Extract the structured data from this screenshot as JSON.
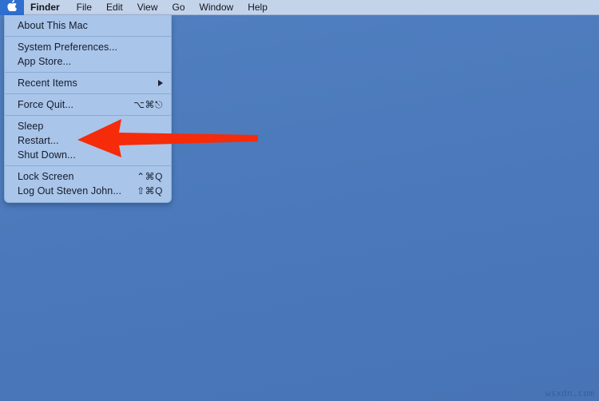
{
  "colors": {
    "desktop": "#4d7cbd",
    "menubar_bg": "#c3d3ea",
    "menu_bg": "#a9c5e9",
    "apple_highlight": "#2f6fd0",
    "arrow_red": "#f52b0a",
    "text": "#151b2c"
  },
  "menubar": {
    "apple_icon": "apple-logo-icon",
    "apple_glyph": "",
    "items": [
      {
        "label": "Finder",
        "bold": true
      },
      {
        "label": "File",
        "bold": false
      },
      {
        "label": "Edit",
        "bold": false
      },
      {
        "label": "View",
        "bold": false
      },
      {
        "label": "Go",
        "bold": false
      },
      {
        "label": "Window",
        "bold": false
      },
      {
        "label": "Help",
        "bold": false
      }
    ]
  },
  "apple_menu": {
    "groups": [
      {
        "items": [
          {
            "label": "About This Mac",
            "shortcut": "",
            "submenu": false
          }
        ]
      },
      {
        "items": [
          {
            "label": "System Preferences...",
            "shortcut": "",
            "submenu": false
          },
          {
            "label": "App Store...",
            "shortcut": "",
            "submenu": false
          }
        ]
      },
      {
        "items": [
          {
            "label": "Recent Items",
            "shortcut": "",
            "submenu": true
          }
        ]
      },
      {
        "items": [
          {
            "label": "Force Quit...",
            "shortcut": "⌥⌘⎋",
            "submenu": false
          }
        ]
      },
      {
        "items": [
          {
            "label": "Sleep",
            "shortcut": "",
            "submenu": false
          },
          {
            "label": "Restart...",
            "shortcut": "",
            "submenu": false
          },
          {
            "label": "Shut Down...",
            "shortcut": "",
            "submenu": false
          }
        ]
      },
      {
        "items": [
          {
            "label": "Lock Screen",
            "shortcut": "⌃⌘Q",
            "submenu": false
          },
          {
            "label": "Log Out Steven John...",
            "shortcut": "⇧⌘Q",
            "submenu": false
          }
        ]
      }
    ]
  },
  "annotation": {
    "arrow_name": "red-pointer-arrow",
    "points_at": "Restart..."
  },
  "watermark": {
    "text": "wsxdn.com"
  }
}
